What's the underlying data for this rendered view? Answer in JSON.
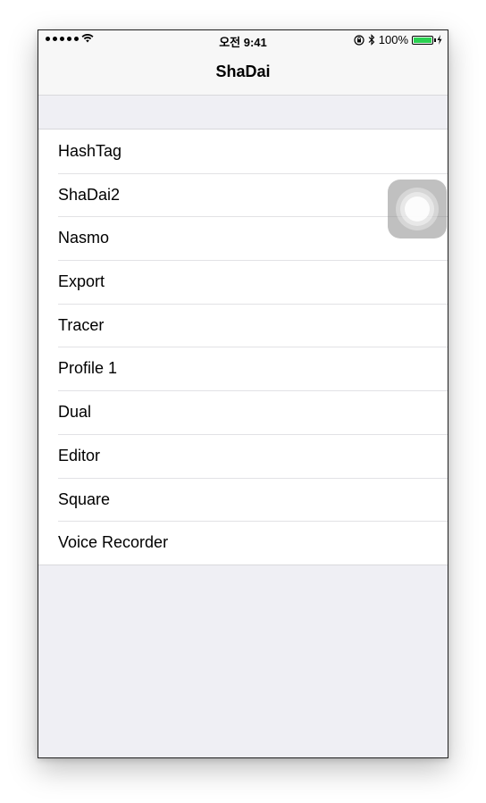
{
  "status_bar": {
    "time": "오전 9:41",
    "battery_percent": "100%",
    "signal_icon": "signal-dots-icon",
    "wifi_icon": "wifi-icon",
    "lock_icon": "orientation-lock-icon",
    "bluetooth_icon": "bluetooth-icon",
    "charging_icon": "charging-bolt-icon",
    "battery_color": "#2ad151"
  },
  "navbar": {
    "title": "ShaDai"
  },
  "menu": {
    "items": [
      {
        "label": "HashTag"
      },
      {
        "label": "ShaDai2"
      },
      {
        "label": "Nasmo"
      },
      {
        "label": "Export"
      },
      {
        "label": "Tracer"
      },
      {
        "label": "Profile 1"
      },
      {
        "label": "Dual"
      },
      {
        "label": "Editor"
      },
      {
        "label": "Square"
      },
      {
        "label": "Voice Recorder"
      }
    ]
  },
  "assistive_touch": {
    "icon": "assistive-touch-icon"
  }
}
